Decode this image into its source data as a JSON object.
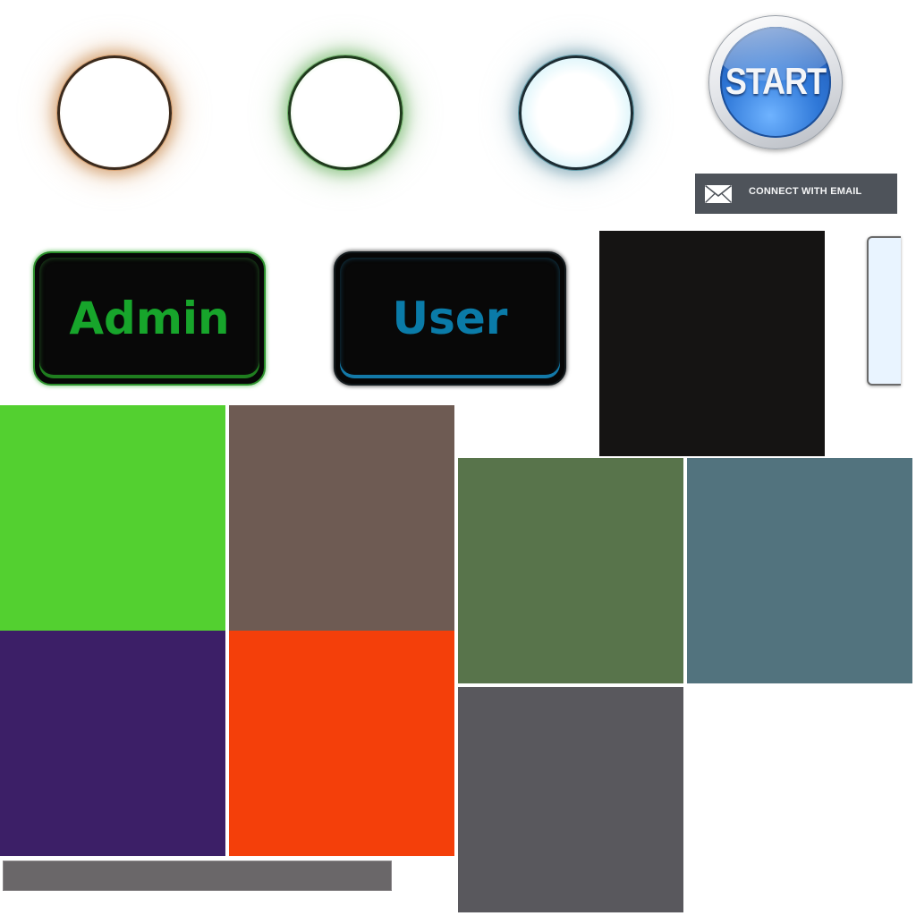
{
  "rings": [
    {
      "name": "orange-ring",
      "color": "#c48346"
    },
    {
      "name": "green-ring",
      "color": "#5aaa50"
    },
    {
      "name": "blue-ring",
      "color": "#5a8ca0"
    }
  ],
  "start_button": {
    "label": "START",
    "color": "#2f78d8"
  },
  "email_button": {
    "label": "CONNECT WITH EMAIL",
    "icon": "envelope-icon",
    "background": "#4e535a"
  },
  "role_buttons": {
    "admin": {
      "label": "Admin",
      "accent": "#17a52b"
    },
    "user": {
      "label": "User",
      "accent": "#0a7ba8"
    }
  },
  "swatches": [
    {
      "name": "dark-swatch",
      "color": "#151413"
    },
    {
      "name": "lime-swatch",
      "color": "#53d030"
    },
    {
      "name": "taupe-swatch",
      "color": "#6e5b53"
    },
    {
      "name": "olive-swatch",
      "color": "#58744b"
    },
    {
      "name": "slate-blue-swatch",
      "color": "#52737e"
    },
    {
      "name": "purple-swatch",
      "color": "#3c1f67"
    },
    {
      "name": "orange-swatch",
      "color": "#f43f0a"
    },
    {
      "name": "charcoal-swatch",
      "color": "#59585d"
    },
    {
      "name": "gray-bar-swatch",
      "color": "#6a6769"
    }
  ]
}
